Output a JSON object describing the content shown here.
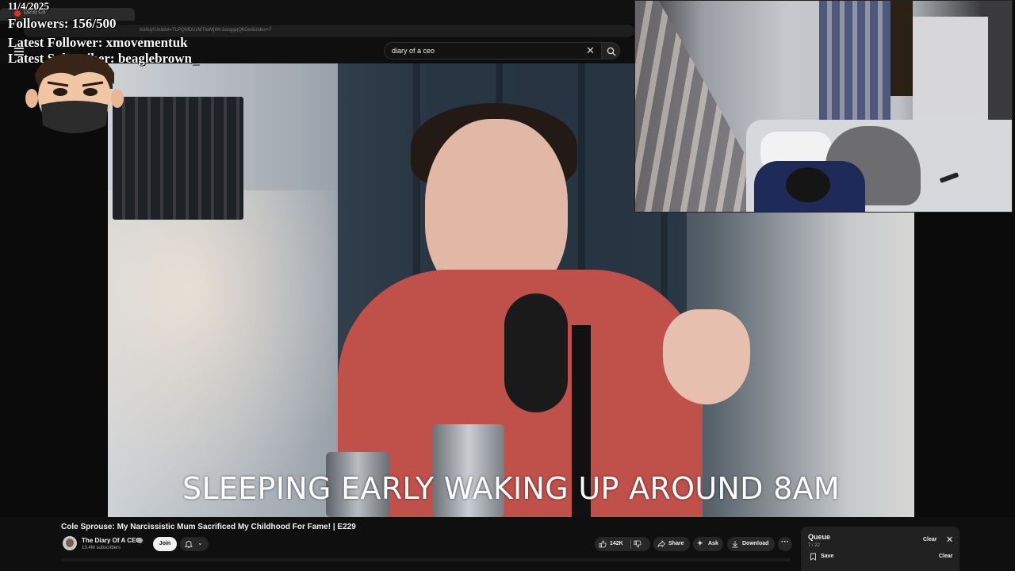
{
  "overlay": {
    "date": "11/4/2025",
    "followers": "Followers: 156/500",
    "latest_follower": "Latest Follower: xmovementuk",
    "latest_subscriber": "Latest Subscriber: beaglebrown_"
  },
  "browser": {
    "tab_title": "(323) Co",
    "address": "list/tuy!Uo&list=TLPQMDUzMTIwMjWn1wsggqQbGw&index=7"
  },
  "search": {
    "query": "diary of a ceo",
    "clear_icon": "close-icon",
    "search_icon": "search-icon"
  },
  "video": {
    "caption": "SLEEPING EARLY WAKING UP AROUND 8AM",
    "title": "Cole Sprouse: My Narcissistic Mum Sacrificed My Childhood For Fame! | E229"
  },
  "channel": {
    "name": "The Diary Of A CEO",
    "subscribers": "13.4M subscribers",
    "join_label": "Join"
  },
  "actions": {
    "like_count": "142K",
    "share_label": "Share",
    "ask_label": "Ask",
    "download_label": "Download",
    "more_label": "···"
  },
  "queue": {
    "title": "Queue",
    "count": "7 / 22",
    "clear_label": "Clear",
    "save_label": "Save",
    "clear_label_2": "Clear",
    "close_symbol": "✕"
  },
  "colors": {
    "background": "#0f0f0f",
    "pill": "#272727",
    "accent_red": "#e52d27",
    "shirt": "#c0504a"
  }
}
